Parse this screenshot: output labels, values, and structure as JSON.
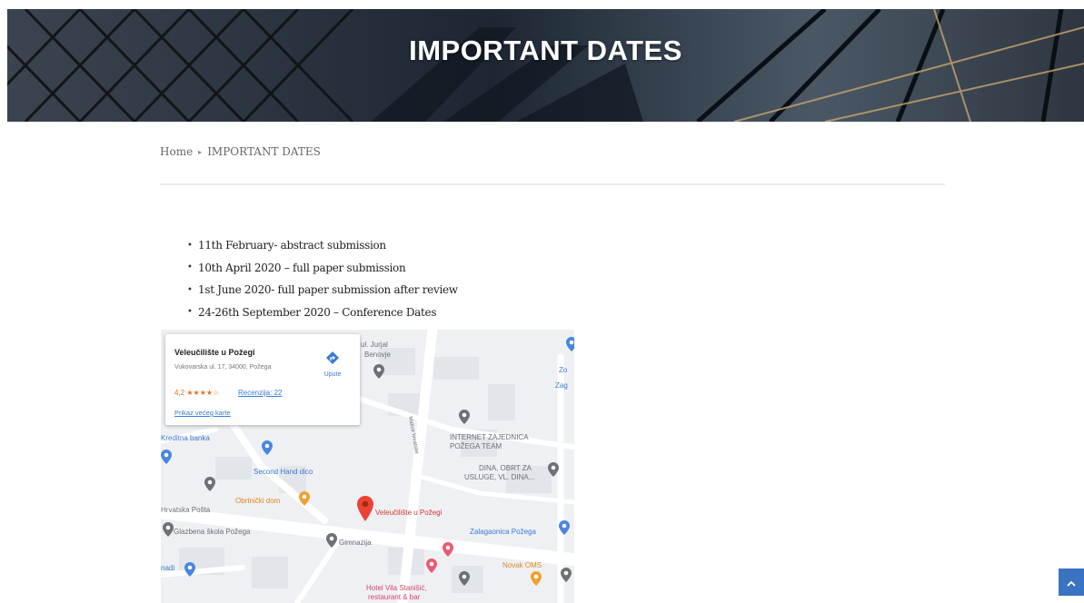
{
  "hero": {
    "title": "IMPORTANT DATES"
  },
  "breadcrumb": {
    "home": "Home",
    "separator": "▸",
    "current": "IMPORTANT DATES"
  },
  "dates": [
    "11th February- abstract submission",
    "10th April 2020 – full paper submission",
    "1st June 2020- full paper submission after review",
    "24-26th September 2020 – Conference Dates"
  ],
  "map": {
    "place_card": {
      "name": "Veleučilište u Požegi",
      "address": "Vukovarska ul. 17, 34000, Požega",
      "rating": "4,2 ★★★★☆",
      "reviews": "Recenzija: 22",
      "directions_label": "Upute",
      "larger_map": "Prikaz većeg karte"
    },
    "labels": {
      "juraj": "ul. Jurjal",
      "juraj2": "Benovje",
      "kreditna_banka": "Kreditna banka",
      "second_hand": "Second Hand dico",
      "hrvatska_posta": "Hrvatska Pošta",
      "obrtnicki_dom": "Obrtnički dom",
      "glazbena_skola": "Glazbena škola Požega",
      "gimnazija": "Gimnazija",
      "veleuciliste": "Veleučilište u Požegi",
      "internet_1": "INTERNET ZAJEDNICA",
      "internet_2": "POŽEGA TEAM",
      "dina_1": "DINA, OBRT ZA",
      "dina_2": "USLUGE, VL. DINA...",
      "zalagaonica": "Zalagaonica Požega",
      "novak": "Novak OMS",
      "hotel_1": "Hotel Vila Stanišić,",
      "hotel_2": "restaurant & bar",
      "zoo": "Zo",
      "zag": "Zag",
      "edge_left": "nadi",
      "street": "Matice hrvatske"
    },
    "colors": {
      "land": "#eef0f3",
      "road": "#ffffff",
      "poi_grey": "#6c7176",
      "poi_blue": "#3a7bd5",
      "poi_orange": "#f0a030",
      "pin_red": "#ea4335"
    }
  },
  "colors": {
    "accent": "#3a73c2",
    "divider": "#ececec"
  },
  "icons": {
    "back_to_top": "chevron-up-icon",
    "directions": "directions-icon",
    "location_pin": "location-pin-icon"
  }
}
